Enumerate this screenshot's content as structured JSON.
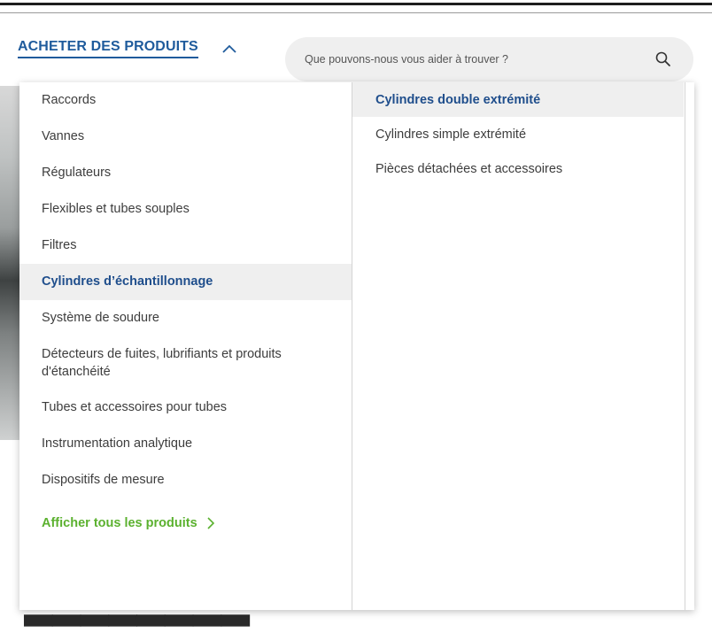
{
  "header": {
    "shop_label": "ACHETER DES PRODUITS",
    "search_placeholder": "Que pouvons-nous vous aider à trouver ?",
    "icons": {
      "toggle": "chevron-up-icon",
      "search": "search-icon"
    }
  },
  "menu": {
    "categories": [
      {
        "label": "Raccords"
      },
      {
        "label": "Vannes"
      },
      {
        "label": "Régulateurs"
      },
      {
        "label": "Flexibles et tubes souples"
      },
      {
        "label": "Filtres"
      },
      {
        "label": "Cylindres d’échantillonnage",
        "active": true
      },
      {
        "label": "Système de soudure"
      },
      {
        "label": "Détecteurs de fuites, lubrifiants et produits d'étanchéité"
      },
      {
        "label": "Tubes et accessoires pour tubes"
      },
      {
        "label": "Instrumentation analytique"
      },
      {
        "label": "Dispositifs de mesure"
      }
    ],
    "show_all_label": "Afficher tous les produits",
    "subcategories": [
      {
        "label": "Cylindres double extrémité",
        "active": true
      },
      {
        "label": "Cylindres simple extrémité"
      },
      {
        "label": "Pièces détachées et accessoires"
      }
    ]
  },
  "colors": {
    "brand_blue": "#1f5b9c",
    "active_text": "#1f4e8c",
    "active_bg": "#efefef",
    "link_green": "#5bb12f"
  }
}
